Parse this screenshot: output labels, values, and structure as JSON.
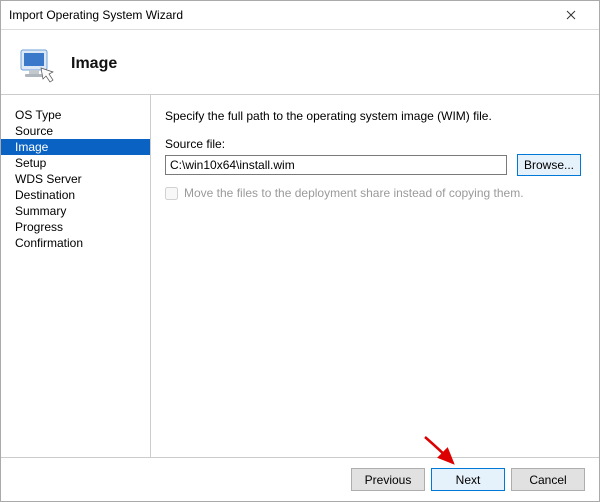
{
  "window": {
    "title": "Import Operating System Wizard"
  },
  "header": {
    "heading": "Image"
  },
  "sidebar": {
    "steps": [
      {
        "label": "OS Type",
        "active": false
      },
      {
        "label": "Source",
        "active": false
      },
      {
        "label": "Image",
        "active": true
      },
      {
        "label": "Setup",
        "active": false
      },
      {
        "label": "WDS Server",
        "active": false
      },
      {
        "label": "Destination",
        "active": false
      },
      {
        "label": "Summary",
        "active": false
      },
      {
        "label": "Progress",
        "active": false
      },
      {
        "label": "Confirmation",
        "active": false
      }
    ]
  },
  "content": {
    "instruction": "Specify the full path to the operating system image (WIM) file.",
    "source_label": "Source file:",
    "source_value": "C:\\win10x64\\install.wim",
    "browse_label": "Browse...",
    "move_option_label": "Move the files to the deployment share instead of copying them.",
    "move_option_checked": false,
    "move_option_enabled": false
  },
  "footer": {
    "previous": "Previous",
    "next": "Next",
    "cancel": "Cancel"
  }
}
